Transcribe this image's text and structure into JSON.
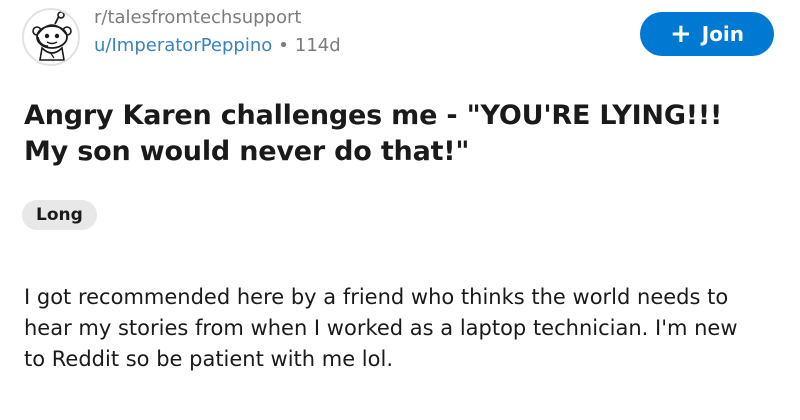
{
  "post": {
    "subreddit": "r/talesfromtechsupport",
    "username": "u/ImperatorPeppino",
    "separator": "•",
    "age": "114d",
    "join_label": "Join",
    "join_icon": "plus-icon",
    "title": "Angry Karen challenges me - \"YOU'RE LYING!!! My son would never do that!\"",
    "flair": "Long",
    "body": "I got recommended here by a friend who thinks the world needs to hear my stories from when I worked as a laptop technician. I'm new to Reddit so be patient with me lol."
  },
  "colors": {
    "join_button": "#0079d3",
    "username": "#3b82c4",
    "muted_text": "#7c7c7c",
    "flair_background": "#e8e8e8"
  }
}
